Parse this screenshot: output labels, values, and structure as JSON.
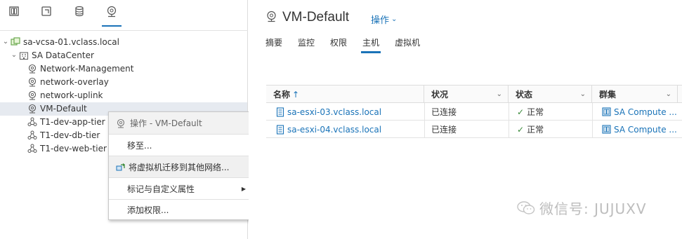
{
  "navigator": {
    "tabs": [
      {
        "icon": "hosts-clusters-icon"
      },
      {
        "icon": "vms-templates-icon"
      },
      {
        "icon": "storage-icon"
      },
      {
        "icon": "networking-icon",
        "active": true
      }
    ],
    "tree": {
      "vcenter": "sa-vcsa-01.vclass.local",
      "datacenter": "SA DataCenter",
      "networks": [
        {
          "label": "Network-Management",
          "type": "network"
        },
        {
          "label": "network-overlay",
          "type": "network"
        },
        {
          "label": "network-uplink",
          "type": "network"
        },
        {
          "label": "VM-Default",
          "type": "network",
          "selected": true
        },
        {
          "label": "T1-dev-app-tier",
          "type": "segment"
        },
        {
          "label": "T1-dev-db-tier",
          "type": "segment"
        },
        {
          "label": "T1-dev-web-tier",
          "type": "segment"
        }
      ]
    }
  },
  "context_menu": {
    "header": "操作 - VM-Default",
    "items": [
      {
        "label": "移至..."
      },
      {
        "label": "将虚拟机迁移到其他网络..."
      },
      {
        "label": "标记与自定义属性"
      },
      {
        "label": "添加权限..."
      }
    ]
  },
  "main": {
    "title": "VM-Default",
    "actions_label": "操作",
    "tabs": [
      "摘要",
      "监控",
      "权限",
      "主机",
      "虚拟机"
    ],
    "active_tab": "主机",
    "table": {
      "columns": [
        "名称",
        "状况",
        "状态",
        "群集"
      ],
      "sort_indicator": "↑",
      "rows": [
        {
          "name": "sa-esxi-03.vclass.local",
          "condition": "已连接",
          "status": "正常",
          "cluster": "SA Compute ..."
        },
        {
          "name": "sa-esxi-04.vclass.local",
          "condition": "已连接",
          "status": "正常",
          "cluster": "SA Compute ..."
        }
      ]
    }
  },
  "watermark": {
    "text": "微信号: JUJUXV"
  },
  "colors": {
    "accent": "#1a73b8",
    "selected_row": "#e6eaf0",
    "status_ok": "#3a8a3a"
  }
}
